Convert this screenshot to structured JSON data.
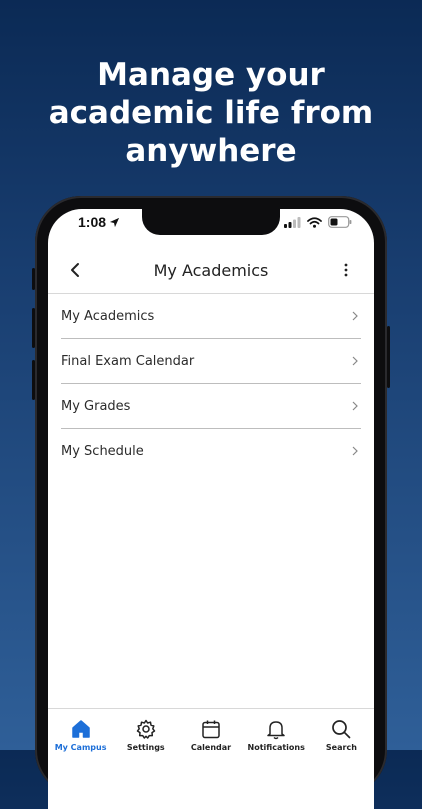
{
  "headline": {
    "line1": "Manage your",
    "line2": "academic life from",
    "line3": "anywhere"
  },
  "status_bar": {
    "time": "1:08"
  },
  "navbar": {
    "title": "My Academics",
    "back_icon": "chevron-left-icon",
    "more_icon": "more-vertical-icon"
  },
  "menu": {
    "items": [
      {
        "label": "My Academics"
      },
      {
        "label": "Final Exam Calendar"
      },
      {
        "label": "My Grades"
      },
      {
        "label": "My Schedule"
      }
    ]
  },
  "tabbar": {
    "items": [
      {
        "label": "My Campus",
        "icon": "home-icon",
        "active": true
      },
      {
        "label": "Settings",
        "icon": "gear-icon",
        "active": false
      },
      {
        "label": "Calendar",
        "icon": "calendar-icon",
        "active": false
      },
      {
        "label": "Notifications",
        "icon": "bell-icon",
        "active": false
      },
      {
        "label": "Search",
        "icon": "search-icon",
        "active": false
      }
    ]
  },
  "colors": {
    "accent": "#1d6fd8",
    "background_top": "#0b2a55",
    "background_bottom": "#2f5f98"
  }
}
